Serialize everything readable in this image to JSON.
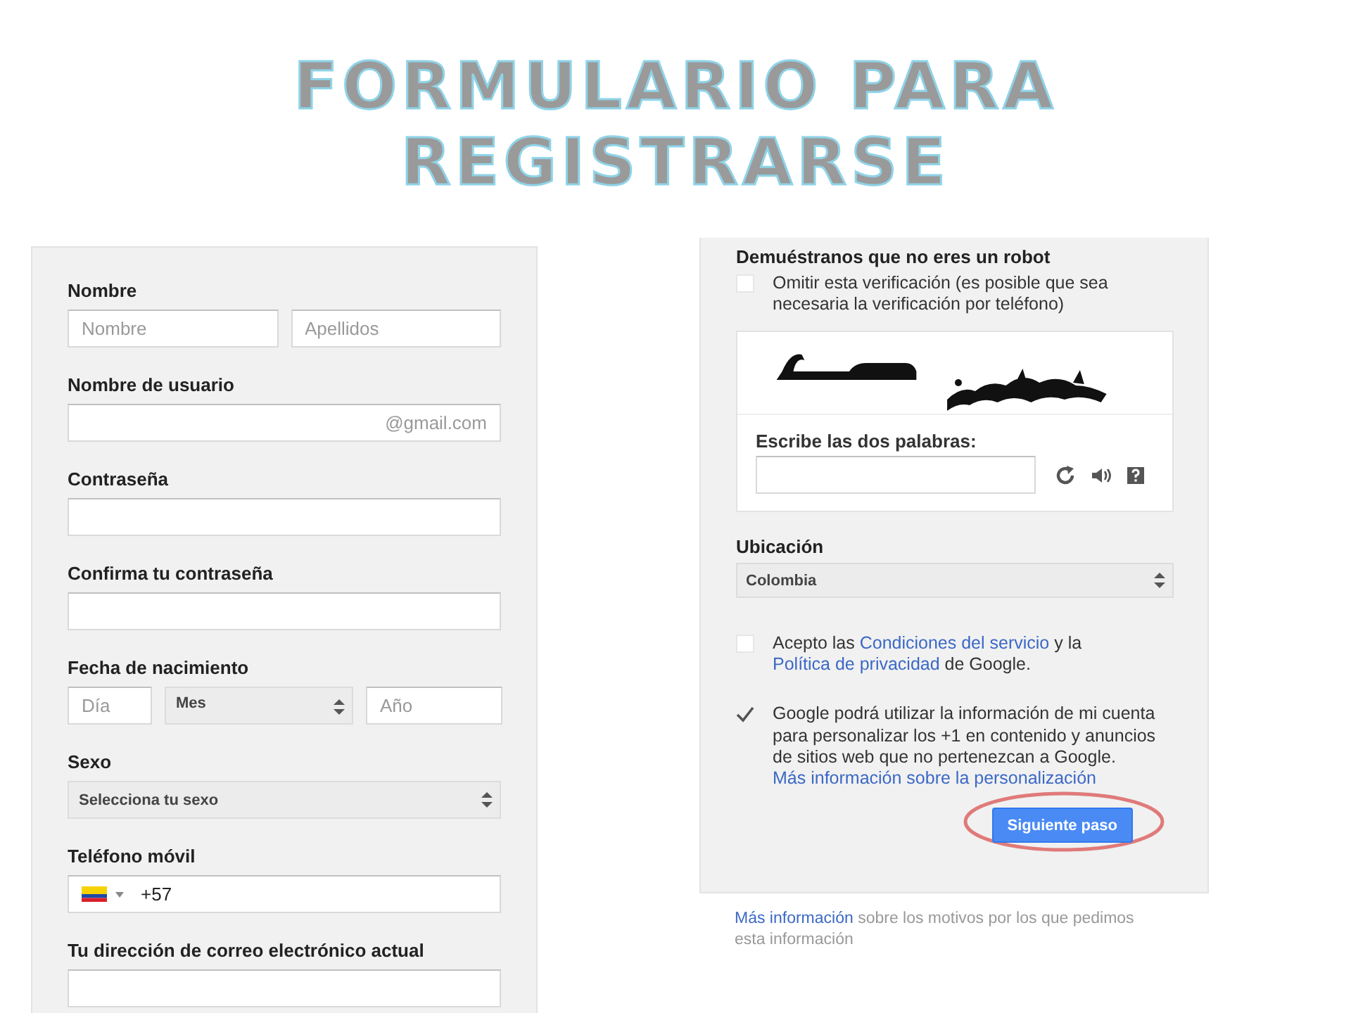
{
  "title": {
    "lines": [
      "FORMULARIO PARA",
      "REGISTRARSE"
    ]
  },
  "left_form": {
    "sections": [
      {
        "label": "Nombre",
        "kind": "pair",
        "inputs": [
          {
            "placeholder": "Nombre"
          },
          {
            "placeholder": "Apellidos"
          }
        ]
      },
      {
        "label": "Nombre de usuario",
        "kind": "suffix",
        "suffix": "@gmail.com"
      },
      {
        "label": "Contraseña",
        "kind": "text"
      },
      {
        "label": "Confirma tu contraseña",
        "kind": "text"
      },
      {
        "label": "Fecha de nacimiento",
        "kind": "date",
        "day_placeholder": "Día",
        "month": "Mes",
        "year_placeholder": "Año"
      },
      {
        "label": "Sexo",
        "kind": "select",
        "value": "Selecciona tu sexo"
      },
      {
        "label": "Teléfono móvil",
        "kind": "phone",
        "value": "+57"
      },
      {
        "label": "Tu dirección de correo electrónico actual",
        "kind": "text"
      }
    ]
  },
  "right_form": {
    "robot": {
      "heading": "Demuéstranos que no eres un robot",
      "skip": {
        "label": "Omitir esta verificación (es posible que sea necesaria la verificación por teléfono)",
        "checked": false
      },
      "captcha": {
        "prompt": "Escribe las dos palabras:"
      }
    },
    "location": {
      "label": "Ubicación",
      "value": "Colombia"
    },
    "agreements": [
      {
        "checked": false,
        "segments": [
          {
            "text": "Acepto las "
          },
          {
            "text": "Condiciones del servicio",
            "link": true
          },
          {
            "text": " y la "
          },
          {
            "text": "Política de privacidad",
            "link": true
          },
          {
            "text": " de Google."
          }
        ]
      },
      {
        "checked": true,
        "segments": [
          {
            "text": "Google podrá utilizar la información de mi cuenta para personalizar los +1 en contenido y anuncios de sitios web que no pertenezcan a Google. "
          },
          {
            "text": "Más información sobre la personalización",
            "link": true
          }
        ]
      }
    ],
    "next_button": {
      "label": "Siguiente paso",
      "circled": true
    }
  },
  "footer": {
    "segments": [
      {
        "text": "Más información",
        "link": true
      },
      {
        "text": " sobre los motivos por los que pedimos esta información"
      }
    ]
  }
}
